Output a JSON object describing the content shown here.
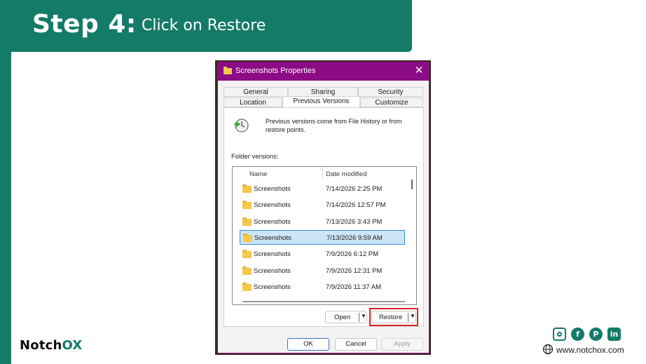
{
  "banner": {
    "step": "Step 4:",
    "description": "Click on Restore"
  },
  "dialog": {
    "title": "Screenshots Properties",
    "close_icon": "close-icon",
    "tabs_top": [
      {
        "label": "General"
      },
      {
        "label": "Sharing"
      },
      {
        "label": "Security"
      }
    ],
    "tabs_bottom": [
      {
        "label": "Location"
      },
      {
        "label": "Previous Versions",
        "active": true
      },
      {
        "label": "Customize"
      }
    ],
    "info_text": "Previous versions come from File History or from restore points.",
    "folder_versions_label": "Folder versions:",
    "columns": {
      "name": "Name",
      "date": "Date modified"
    },
    "rows": [
      {
        "name": "Screenshots",
        "date": "7/14/2026 2:25 PM",
        "selected": false
      },
      {
        "name": "Screenshots",
        "date": "7/14/2026 12:57 PM",
        "selected": false
      },
      {
        "name": "Screenshots",
        "date": "7/13/2026 3:43 PM",
        "selected": false
      },
      {
        "name": "Screenshots",
        "date": "7/13/2026 9:59 AM",
        "selected": true
      },
      {
        "name": "Screenshots",
        "date": "7/9/2026 6:12 PM",
        "selected": false
      },
      {
        "name": "Screenshots",
        "date": "7/9/2026 12:31 PM",
        "selected": false
      },
      {
        "name": "Screenshots",
        "date": "7/9/2026 11:37 AM",
        "selected": false
      }
    ],
    "buttons": {
      "open": "Open",
      "restore": "Restore",
      "ok": "OK",
      "cancel": "Cancel",
      "apply": "Apply"
    }
  },
  "brand": {
    "logo_main": "Notch",
    "logo_accent": "OX",
    "website": "www.notchox.com",
    "accent_color": "#137b68",
    "highlight_color": "#d7262b",
    "titlebar_color": "#8b0c85"
  },
  "social": [
    "instagram-icon",
    "facebook-icon",
    "pinterest-icon",
    "linkedin-icon"
  ]
}
